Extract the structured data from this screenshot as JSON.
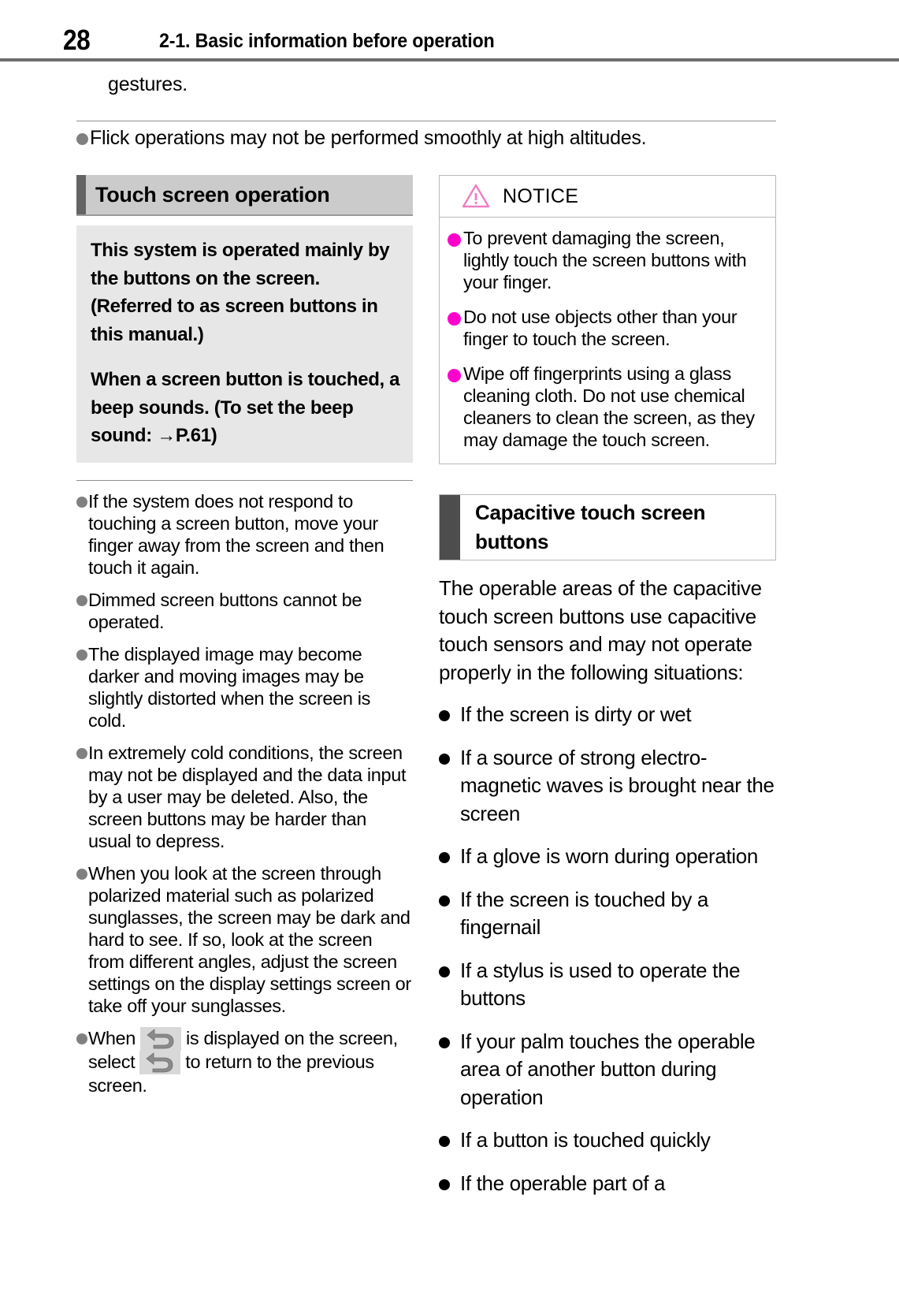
{
  "header": {
    "page_number": "28",
    "section_title": "2-1. Basic information before operation"
  },
  "intro": {
    "continued_text": "gestures.",
    "bullet": "Flick operations may not be performed smoothly at high altitudes."
  },
  "left_column": {
    "heading": "Touch screen operation",
    "lead_paragraphs": [
      "This system is operated mainly by the buttons on the screen. (Referred to as screen buttons in this manual.)",
      "When a screen button is touched, a beep sounds. (To set the beep sound: "
    ],
    "lead_reference_arrow": "→",
    "lead_reference": "P.61)",
    "notes": [
      "If the system does not respond to touching a screen button, move your finger away from the screen and then touch it again.",
      "Dimmed screen buttons cannot be operated.",
      "The displayed image may become darker and moving images may be slightly distorted when the screen is cold.",
      "In extremely cold conditions, the screen may not be displayed and the data input by a user may be deleted. Also, the screen buttons may be harder than usual to depress.",
      "When you look at the screen through polarized material such as polarized sunglasses, the screen may be dark and hard to see. If so, look at the screen from different angles, adjust the screen settings on the display settings screen or take off your sunglasses."
    ],
    "return_note": {
      "part1": "When",
      "part2": "is displayed on the screen, select",
      "part3": "to return to the previous screen."
    }
  },
  "right_column": {
    "notice": {
      "title": "NOTICE",
      "icon": "warning-triangle-icon",
      "bullet_color": "#ff00cc",
      "items": [
        "To prevent damaging the screen, lightly touch the screen buttons with your finger.",
        "Do not use objects other than your finger to touch the screen.",
        "Wipe off fingerprints using a glass cleaning cloth. Do not use chemical cleaners to clean the screen, as they may damage the touch screen."
      ]
    },
    "subsection": {
      "heading": "Capacitive touch screen buttons",
      "body": "The operable areas of the capacitive touch screen buttons use capacitive touch sensors and may not operate properly in the following situations:",
      "items": [
        "If the screen is dirty or wet",
        "If a source of strong electro-magnetic waves is brought near the screen",
        "If a glove is worn during operation",
        "If the screen is touched by a fingernail",
        "If a stylus is used to operate the buttons",
        "If your palm touches the operable area of another button during operation",
        "If a button is touched quickly",
        "If the operable part of a"
      ]
    }
  }
}
